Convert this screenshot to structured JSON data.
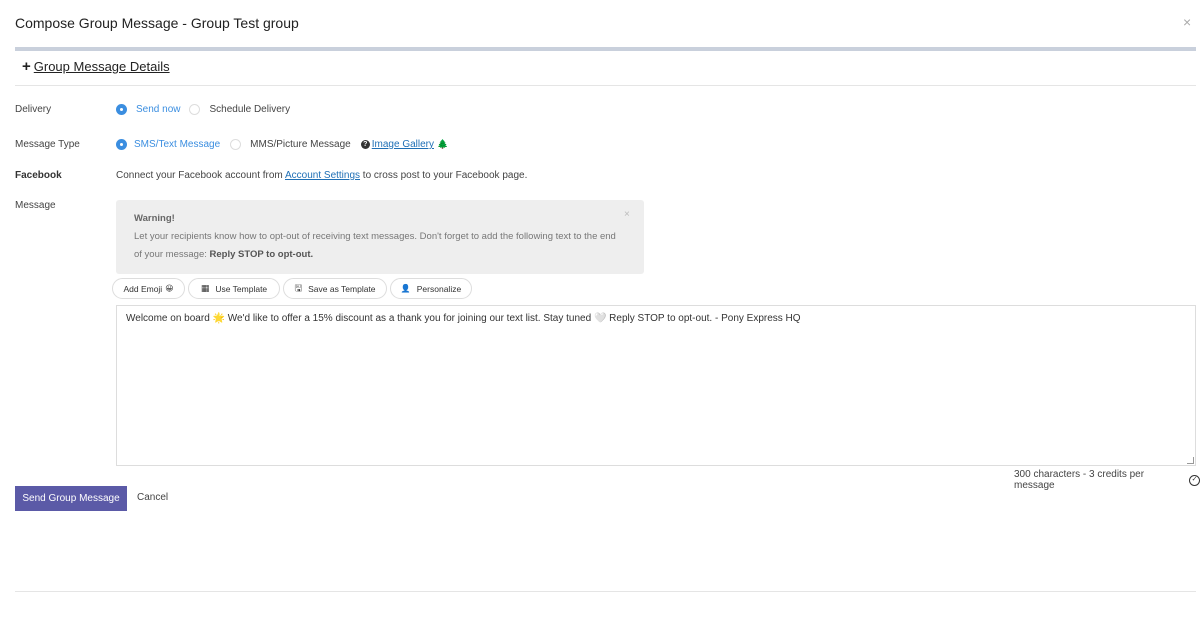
{
  "modal": {
    "title": "Compose Group Message - Group Test group",
    "close_glyph": "×"
  },
  "details_toggle": {
    "plus_glyph": "+",
    "label": "Group Message Details"
  },
  "delivery": {
    "label": "Delivery",
    "options": [
      {
        "label": "Send now",
        "selected": true
      },
      {
        "label": "Schedule Delivery",
        "selected": false
      }
    ]
  },
  "message_type": {
    "label": "Message Type",
    "options": [
      {
        "label": "SMS/Text Message",
        "selected": true
      },
      {
        "label": "MMS/Picture Message",
        "selected": false
      }
    ],
    "help_glyph": "?",
    "gallery_link": "Image Gallery",
    "tree_glyph": "🌲"
  },
  "facebook": {
    "label": "Facebook",
    "text_before": "Connect your Facebook account from ",
    "link": "Account Settings",
    "text_after": " to cross post to your Facebook page."
  },
  "message": {
    "label": "Message",
    "warning": {
      "title": "Warning!",
      "body": "Let your recipients know how to opt-out of receiving text messages. Don't forget to add the following text to the end of your message: ",
      "emphasis": "Reply STOP to opt-out.",
      "close_glyph": "×"
    },
    "toolbar": [
      {
        "label": "Add Emoji",
        "icon": "😀",
        "icon_name": "emoji-icon",
        "position": "after"
      },
      {
        "label": "Use Template",
        "icon": "▦",
        "icon_name": "grid-icon",
        "position": "before"
      },
      {
        "label": "Save as Template",
        "icon": "🖫",
        "icon_name": "save-icon",
        "position": "before"
      },
      {
        "label": "Personalize",
        "icon": "👤",
        "icon_name": "user-icon",
        "position": "before"
      }
    ],
    "body": "Welcome on board 🌟 We'd like to offer a 15% discount as a thank you for joining our text list. Stay tuned 🤍 Reply STOP to opt-out. - Pony Express HQ",
    "counter": "300 characters - 3 credits per message",
    "check_glyph": "✓"
  },
  "actions": {
    "send_label": "Send Group Message",
    "cancel_label": "Cancel",
    "send_color": "#5b5aa7"
  }
}
